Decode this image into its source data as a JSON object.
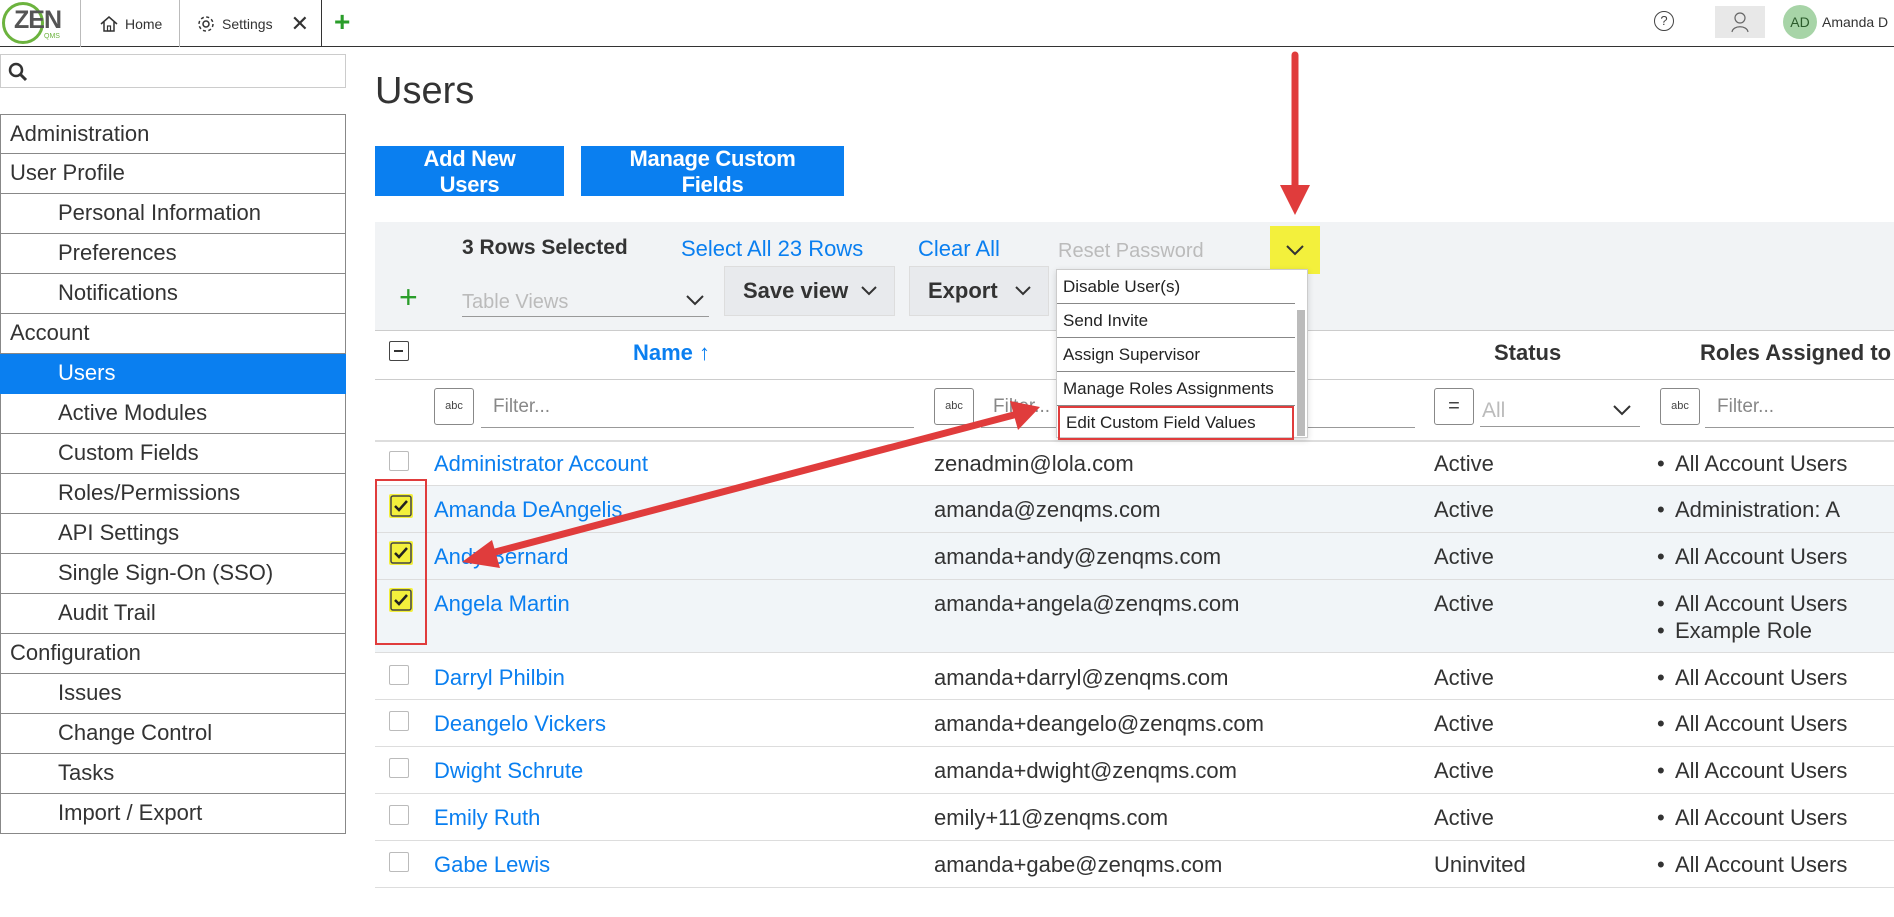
{
  "topbar": {
    "logo_text": "ZEN",
    "logo_sub": "QMS",
    "tabs": [
      {
        "label": "Home",
        "icon": "home-icon"
      },
      {
        "label": "Settings",
        "icon": "gear-icon",
        "close": "✕"
      }
    ],
    "add_tab": "+",
    "help": "?",
    "avatar_initials": "AD",
    "user_name": "Amanda D"
  },
  "sidebar": {
    "search_placeholder": "",
    "items": [
      {
        "label": "Administration",
        "level": "section"
      },
      {
        "label": "User Profile",
        "level": "section"
      },
      {
        "label": "Personal Information",
        "level": "sub"
      },
      {
        "label": "Preferences",
        "level": "sub"
      },
      {
        "label": "Notifications",
        "level": "sub"
      },
      {
        "label": "Account",
        "level": "section"
      },
      {
        "label": "Users",
        "level": "sub",
        "active": true
      },
      {
        "label": "Active Modules",
        "level": "sub"
      },
      {
        "label": "Custom Fields",
        "level": "sub"
      },
      {
        "label": "Roles/Permissions",
        "level": "sub"
      },
      {
        "label": "API Settings",
        "level": "sub"
      },
      {
        "label": "Single Sign-On (SSO)",
        "level": "sub"
      },
      {
        "label": "Audit Trail",
        "level": "sub"
      },
      {
        "label": "Configuration",
        "level": "section"
      },
      {
        "label": "Issues",
        "level": "sub"
      },
      {
        "label": "Change Control",
        "level": "sub"
      },
      {
        "label": "Tasks",
        "level": "sub"
      },
      {
        "label": "Import / Export",
        "level": "sub"
      }
    ]
  },
  "main": {
    "title": "Users",
    "add_users_label": "Add New Users",
    "manage_fields_label": "Manage Custom Fields",
    "toolbar": {
      "rows_selected": "3 Rows Selected",
      "select_all": "Select All 23 Rows",
      "clear_all": "Clear All",
      "add": "+",
      "table_views_placeholder": "Table Views",
      "save_view": "Save view",
      "export": "Export",
      "bulk_action_placeholder": "Reset Password"
    },
    "bulk_actions": [
      "Disable User(s)",
      "Send Invite",
      "Assign Supervisor",
      "Manage Roles Assignments",
      "Edit Custom Field Values"
    ],
    "columns": {
      "name": "Name ↑",
      "status": "Status",
      "roles": "Roles Assigned to"
    },
    "filters": {
      "name_placeholder": "Filter...",
      "email_placeholder": "Filter...",
      "status_placeholder": "All",
      "roles_placeholder": "Filter...",
      "text_icon": "abc",
      "equals_icon": "="
    },
    "rows": [
      {
        "name": "Administrator Account",
        "email": "zenadmin@lola.com",
        "status": "Active",
        "roles": [
          "All Account Users"
        ],
        "checked": false
      },
      {
        "name": "Amanda DeAngelis",
        "email": "amanda@zenqms.com",
        "status": "Active",
        "roles": [
          "Administration: A"
        ],
        "checked": true
      },
      {
        "name": "Andy Bernard",
        "email": "amanda+andy@zenqms.com",
        "status": "Active",
        "roles": [
          "All Account Users"
        ],
        "checked": true
      },
      {
        "name": "Angela Martin",
        "email": "amanda+angela@zenqms.com",
        "status": "Active",
        "roles": [
          "All Account Users",
          "Example Role"
        ],
        "checked": true
      },
      {
        "name": "Darryl Philbin",
        "email": "amanda+darryl@zenqms.com",
        "status": "Active",
        "roles": [
          "All Account Users"
        ],
        "checked": false
      },
      {
        "name": "Deangelo Vickers",
        "email": "amanda+deangelo@zenqms.com",
        "status": "Active",
        "roles": [
          "All Account Users"
        ],
        "checked": false
      },
      {
        "name": "Dwight Schrute",
        "email": "amanda+dwight@zenqms.com",
        "status": "Active",
        "roles": [
          "All Account Users"
        ],
        "checked": false
      },
      {
        "name": "Emily Ruth",
        "email": "emily+11@zenqms.com",
        "status": "Active",
        "roles": [
          "All Account Users"
        ],
        "checked": false
      },
      {
        "name": "Gabe Lewis",
        "email": "amanda+gabe@zenqms.com",
        "status": "Uninvited",
        "roles": [
          "All Account Users"
        ],
        "checked": false
      }
    ]
  },
  "colors": {
    "accent": "#0a7ff0",
    "highlight_yellow": "#f3f03c",
    "annotation_red": "#e03c3c",
    "green": "#2a9d2a"
  }
}
